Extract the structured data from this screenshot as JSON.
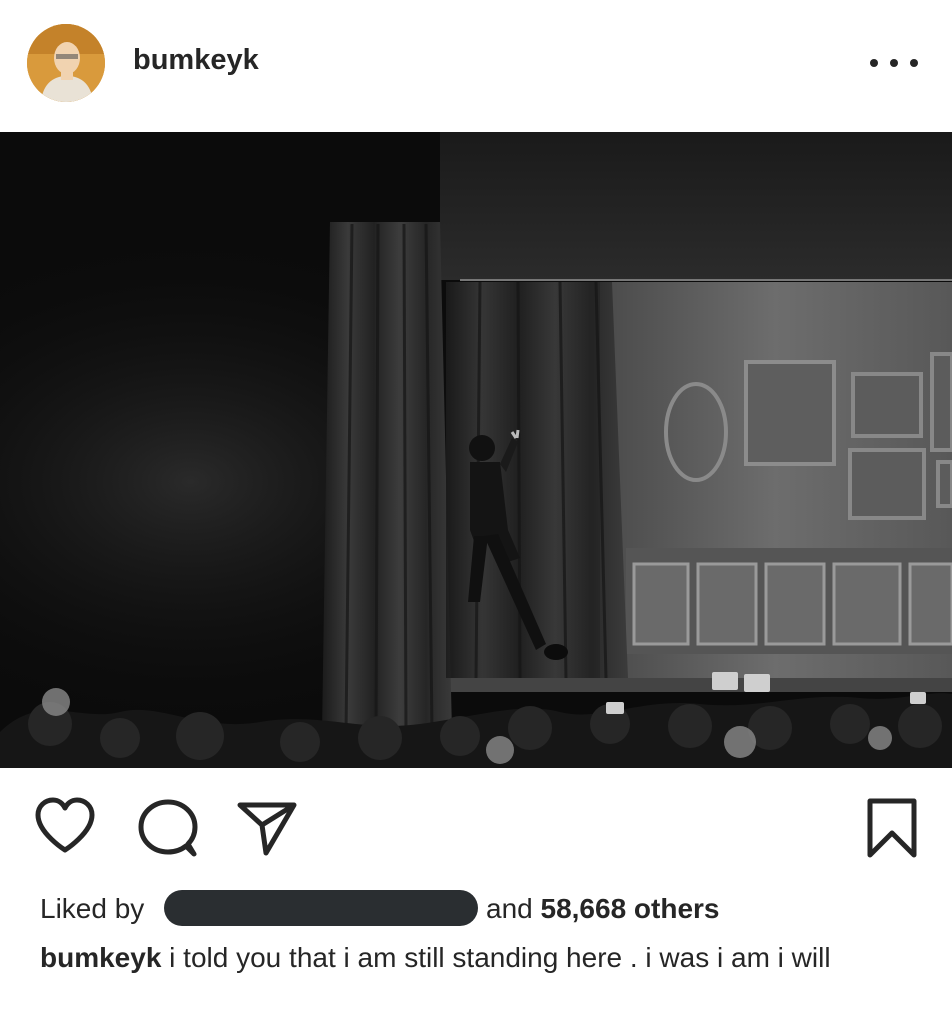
{
  "post": {
    "username": "bumkeyk",
    "avatar_icon": "profile-avatar",
    "more_icon": "more-horizontal-icon"
  },
  "actions": {
    "like_icon": "heart-icon",
    "comment_icon": "comment-icon",
    "share_icon": "direct-send-icon",
    "save_icon": "bookmark-icon"
  },
  "likes": {
    "prefix": "Liked by",
    "and_text": "and",
    "count_text": "58,668 others"
  },
  "caption": {
    "username": "bumkeyk",
    "text": " i told you that i am still standing here . i was i am i will"
  },
  "colors": {
    "text": "#262626",
    "redaction": "#2a2e31",
    "photo_bg": "#0b0b0b"
  }
}
